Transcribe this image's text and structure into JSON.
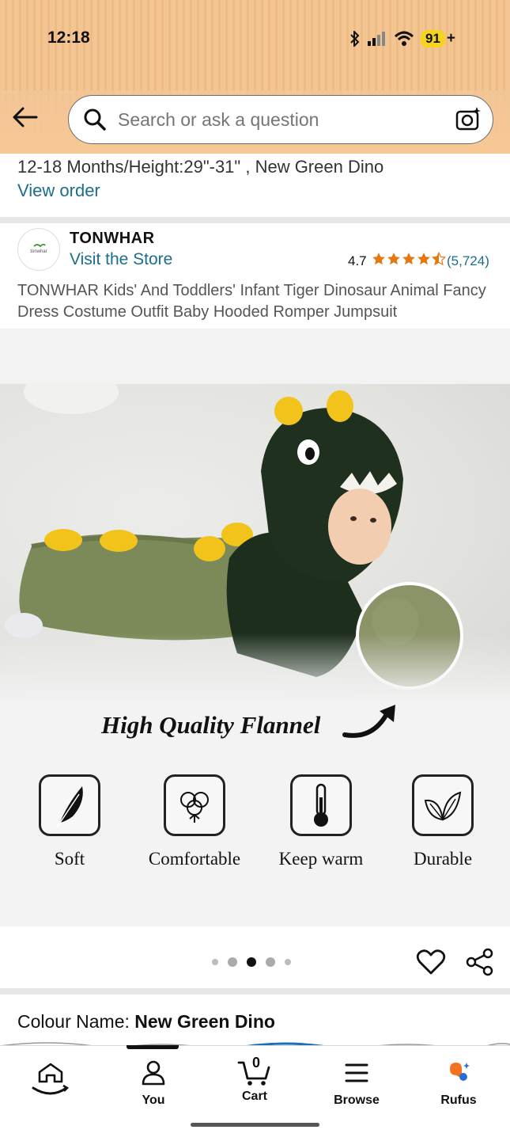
{
  "status_bar": {
    "time": "12:18",
    "battery": "91"
  },
  "search": {
    "placeholder": "Search or ask a question"
  },
  "order": {
    "size_text": "12-18 Months/Height:29\"-31\" , New Green Dino",
    "view_order": "View order"
  },
  "store": {
    "logo_text": "tonwhar",
    "name": "TONWHAR",
    "visit": "Visit the Store",
    "rating": "4.7",
    "rating_stars": 4.5,
    "rating_count": "(5,724)"
  },
  "product": {
    "title": "TONWHAR Kids' And Toddlers' Infant Tiger Dinosaur Animal Fancy Dress Costume Outfit Baby Hooded Romper Jumpsuit"
  },
  "image": {
    "tagline": "High Quality Flannel",
    "features": [
      {
        "label": "Soft",
        "icon": "feather-icon"
      },
      {
        "label": "Comfortable",
        "icon": "cotton-icon"
      },
      {
        "label": "Keep warm",
        "icon": "thermometer-icon"
      },
      {
        "label": "Durable",
        "icon": "leaf-icon"
      }
    ],
    "carousel_total": 5,
    "carousel_active": 3
  },
  "colour": {
    "label": "Colour Name: ",
    "value": "New Green Dino"
  },
  "nav": {
    "items": [
      {
        "label": "",
        "icon": "home-icon"
      },
      {
        "label": "You",
        "icon": "person-icon"
      },
      {
        "label": "Cart",
        "icon": "cart-icon",
        "badge": "0"
      },
      {
        "label": "Browse",
        "icon": "menu-icon"
      },
      {
        "label": "Rufus",
        "icon": "rufus-icon"
      }
    ]
  },
  "colors": {
    "header": "#f0c08c",
    "link": "#1b6e8c",
    "star": "#e47911",
    "battery": "#f5d41f"
  }
}
